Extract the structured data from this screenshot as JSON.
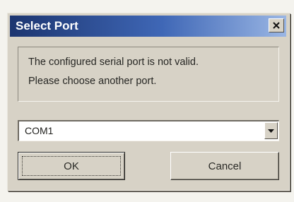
{
  "window": {
    "title": "Select Port",
    "close_icon": "close-icon"
  },
  "message": {
    "line1": "The configured serial port is not valid.",
    "line2": "Please choose another port."
  },
  "port_select": {
    "value": "COM1",
    "dropdown_icon": "chevron-down-icon"
  },
  "buttons": {
    "ok_label": "OK",
    "cancel_label": "Cancel"
  },
  "colors": {
    "title_bar_start": "#1c3570",
    "title_bar_end": "#9ab6e4",
    "dialog_face": "#d7d2c6"
  }
}
